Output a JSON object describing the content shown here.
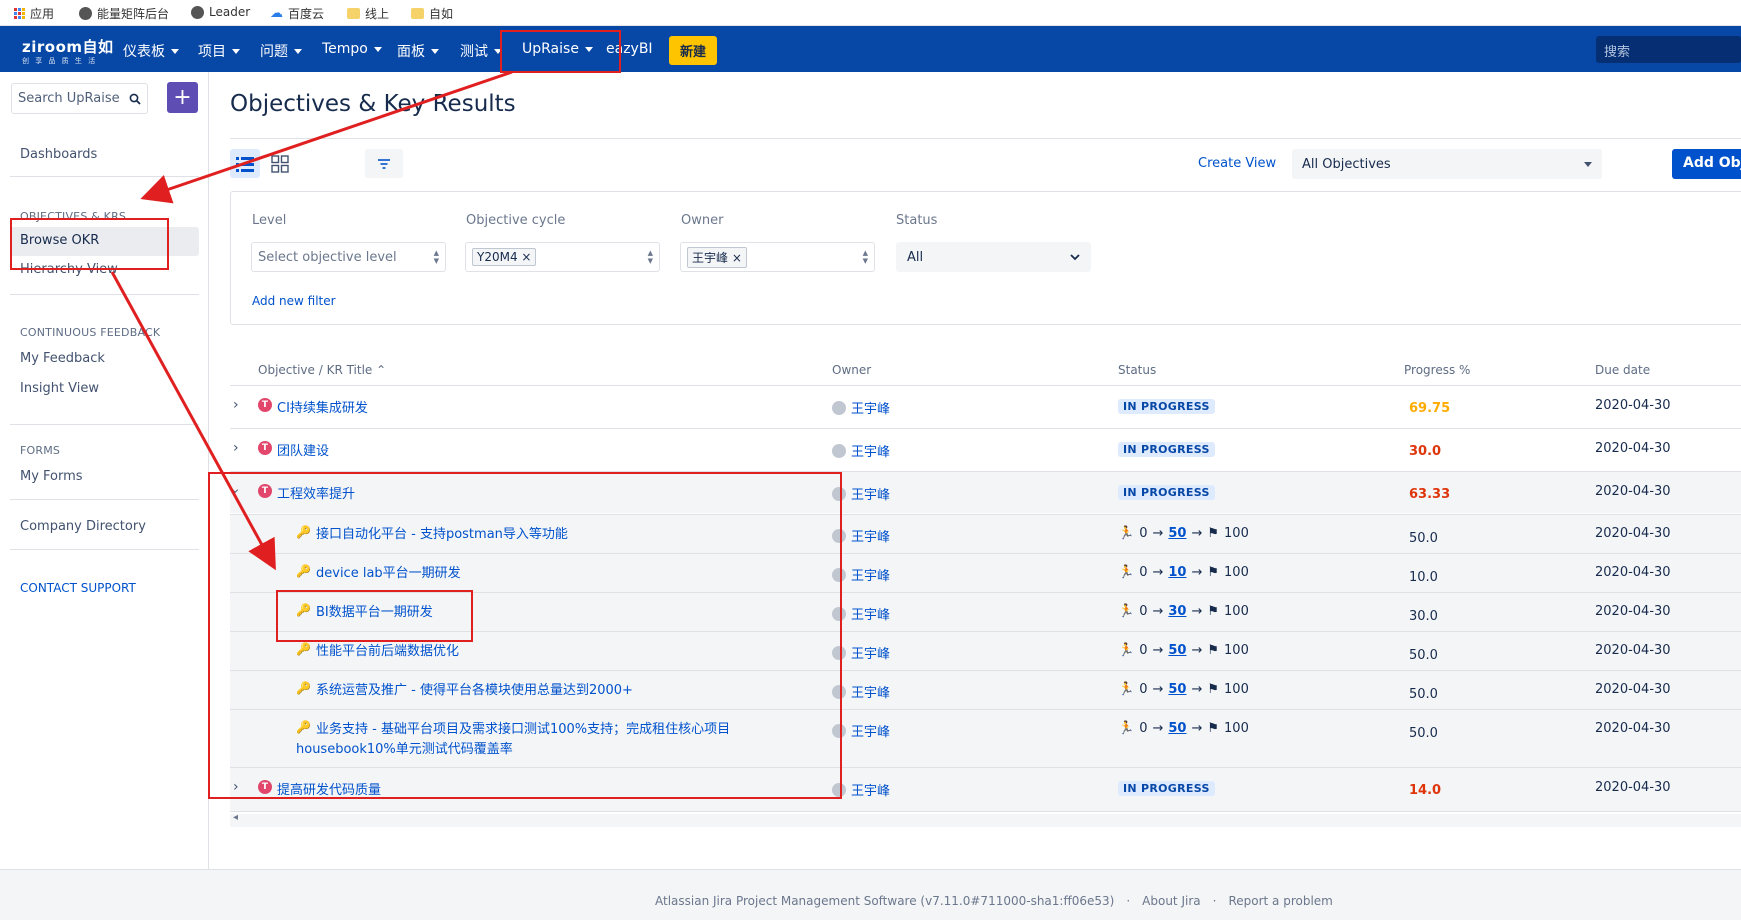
{
  "bookmarks": [
    {
      "label": "应用",
      "icon": "apps-grid-icon"
    },
    {
      "label": "能量矩阵后台",
      "icon": "globe-icon"
    },
    {
      "label": "Leader",
      "icon": "globe-icon"
    },
    {
      "label": "百度云",
      "icon": "cloud-icon"
    },
    {
      "label": "线上",
      "icon": "folder-icon"
    },
    {
      "label": "自如",
      "icon": "folder-icon"
    }
  ],
  "topnav": {
    "logo": "ziroom自如",
    "logo_sub": "创 享 品 质 生 活",
    "items": [
      "仪表板",
      "项目",
      "问题",
      "Tempo",
      "面板",
      "测试",
      "UpRaise",
      "eazyBI"
    ],
    "create_label": "新建",
    "search_placeholder": "搜索",
    "colors": {
      "bar": "#0747a6",
      "create": "#ffc400"
    }
  },
  "sidebar": {
    "search_placeholder": "Search UpRaise",
    "dashboards": "Dashboards",
    "section_okr": "OBJECTIVES & KRS",
    "browse_okr": "Browse OKR",
    "hierarchy_view": "Hierarchy View",
    "section_feedback": "CONTINUOUS FEEDBACK",
    "my_feedback": "My Feedback",
    "insight_view": "Insight View",
    "section_forms": "FORMS",
    "my_forms": "My Forms",
    "company_directory": "Company Directory",
    "contact_support": "CONTACT SUPPORT"
  },
  "main": {
    "title": "Objectives & Key Results",
    "create_view": "Create View",
    "objectives_select": "All Objectives",
    "add_objective": "Add Objective",
    "filters": {
      "level_label": "Level",
      "level_placeholder": "Select objective level",
      "cycle_label": "Objective cycle",
      "cycle_value": "Y20M4",
      "owner_label": "Owner",
      "owner_value": "王宇峰",
      "status_label": "Status",
      "status_value": "All",
      "add_new_filter": "Add new filter"
    }
  },
  "table": {
    "columns": [
      "Objective / KR Title",
      "Owner",
      "Status",
      "Progress %",
      "Due date"
    ],
    "objectives": [
      {
        "title": "CI持续集成研发",
        "owner": "王宇峰",
        "status": "IN PROGRESS",
        "progress": "69.75",
        "progress_color": "#ffab00",
        "due": "2020-04-30",
        "expanded": false
      },
      {
        "title": "团队建设",
        "owner": "王宇峰",
        "status": "IN PROGRESS",
        "progress": "30.0",
        "progress_color": "#de350b",
        "due": "2020-04-30",
        "expanded": false
      },
      {
        "title": "工程效率提升",
        "owner": "王宇峰",
        "status": "IN PROGRESS",
        "progress": "63.33",
        "progress_color": "#de350b",
        "due": "2020-04-30",
        "expanded": true
      },
      {
        "title": "提高研发代码质量",
        "owner": "王宇峰",
        "status": "IN PROGRESS",
        "progress": "14.0",
        "progress_color": "#de350b",
        "due": "2020-04-30",
        "expanded": false
      }
    ],
    "key_results": [
      {
        "title": "接口自动化平台 - 支持postman导入等功能",
        "owner": "王宇峰",
        "start": "0",
        "current": "50",
        "target": "100",
        "progress": "50.0",
        "due": "2020-04-30"
      },
      {
        "title": "device lab平台一期研发",
        "owner": "王宇峰",
        "start": "0",
        "current": "10",
        "target": "100",
        "progress": "10.0",
        "due": "2020-04-30"
      },
      {
        "title": "BI数据平台一期研发",
        "owner": "王宇峰",
        "start": "0",
        "current": "30",
        "target": "100",
        "progress": "30.0",
        "due": "2020-04-30"
      },
      {
        "title": "性能平台前后端数据优化",
        "owner": "王宇峰",
        "start": "0",
        "current": "50",
        "target": "100",
        "progress": "50.0",
        "due": "2020-04-30"
      },
      {
        "title": "系统运营及推广 - 使得平台各模块使用总量达到2000+",
        "owner": "王宇峰",
        "start": "0",
        "current": "50",
        "target": "100",
        "progress": "50.0",
        "due": "2020-04-30"
      },
      {
        "title": "业务支持 - 基础平台项目及需求接口测试100%支持；完成租住核心项目",
        "title_line2": "housebook10%单元测试代码覆盖率",
        "owner": "王宇峰",
        "start": "0",
        "current": "50",
        "target": "100",
        "progress": "50.0",
        "due": "2020-04-30"
      }
    ]
  },
  "footer": {
    "software": "Atlassian Jira Project Management Software (v7.11.0#711000-sha1:ff06e53)",
    "sep": "·",
    "about": "About Jira",
    "report": "Report a problem"
  },
  "annotation_color": "#e02020"
}
